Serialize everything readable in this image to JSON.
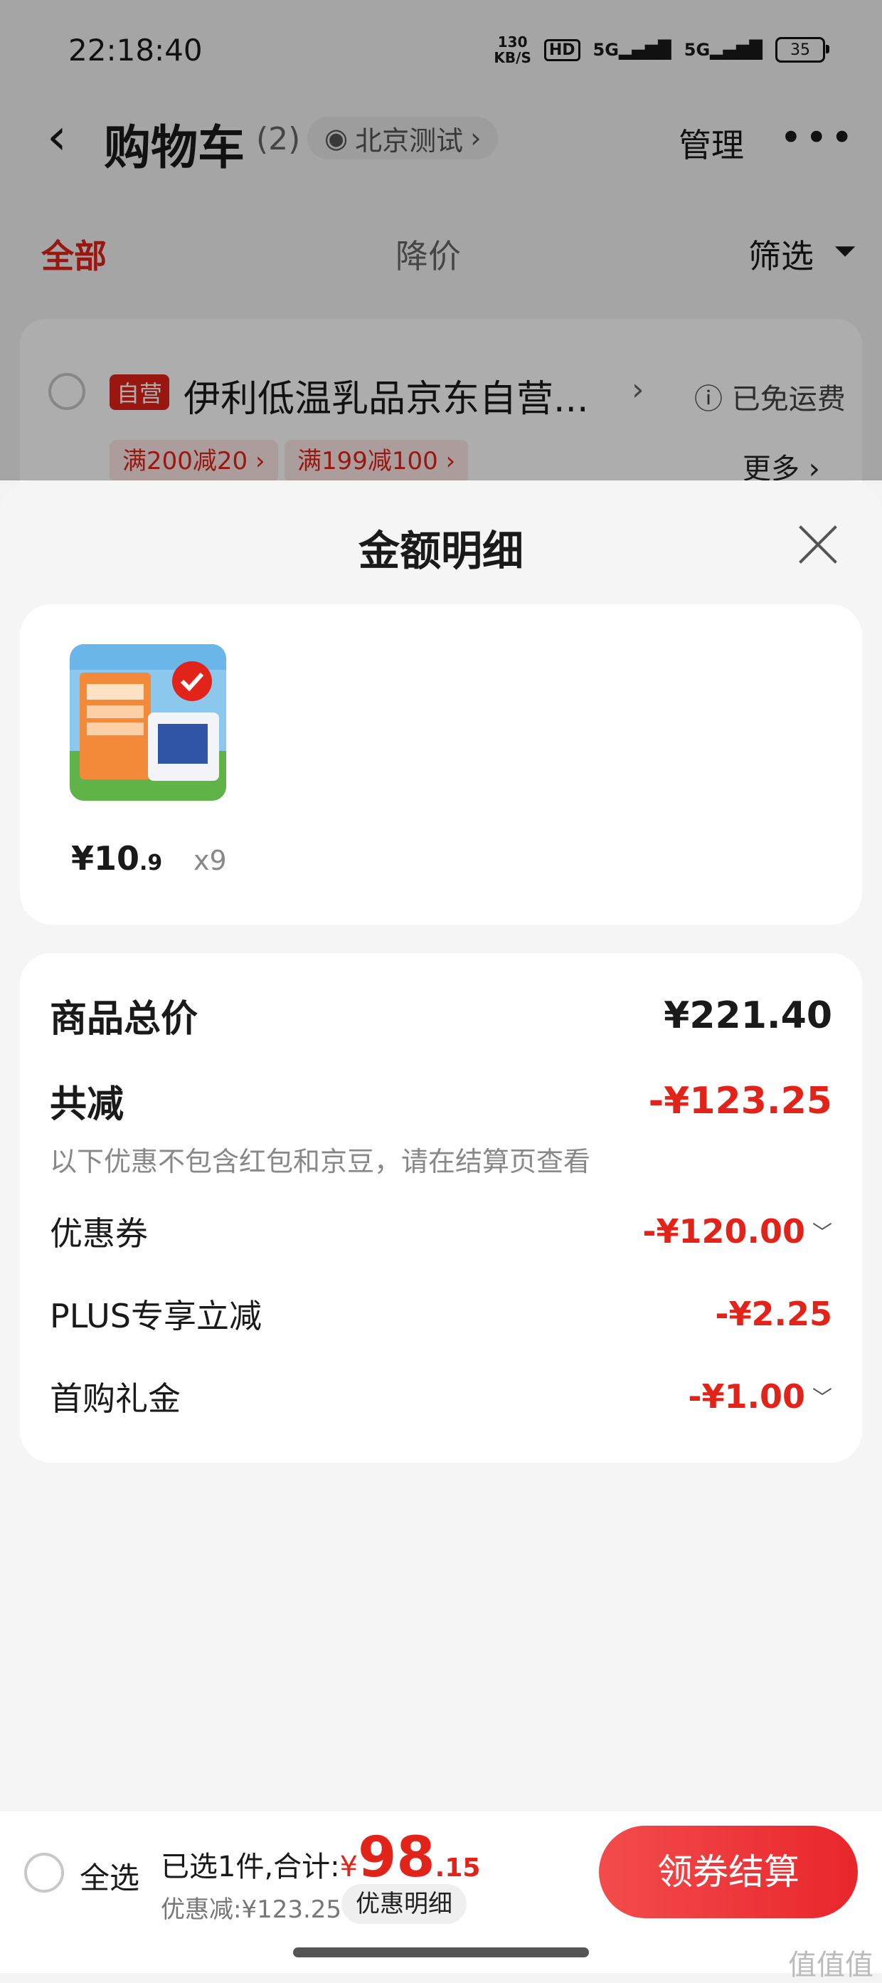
{
  "status_bar": {
    "time": "22:18:40",
    "net_speed_value": "130",
    "net_speed_unit": "KB/S",
    "hd": "HD",
    "signal1": "5G",
    "signal2": "5G",
    "battery": "35"
  },
  "nav": {
    "title": "购物车",
    "count": "(2)",
    "location": "北京测试",
    "manage": "管理",
    "more": "•••"
  },
  "tabs": {
    "all": "全部",
    "price_drop": "降价",
    "filter": "筛选"
  },
  "shop": {
    "badge": "自营",
    "name": "伊利低温乳品京东自营...",
    "shipping": "已免运费",
    "coupons": [
      "满200减20 ›",
      "满199减100 ›"
    ],
    "more": "更多 ›"
  },
  "sheet": {
    "title": "金额明细",
    "product": {
      "price_int": "¥10",
      "price_dec": ".9",
      "qty": "x9"
    },
    "total_label": "商品总价",
    "total_value": "¥221.40",
    "reduce_label": "共减",
    "reduce_value": "-¥123.25",
    "note": "以下优惠不包含红包和京豆，请在结算页查看",
    "items": [
      {
        "label": "优惠券",
        "value": "-¥120.00",
        "expand": "﹀"
      },
      {
        "label": "PLUS专享立减",
        "value": "-¥2.25",
        "expand": ""
      },
      {
        "label": "首购礼金",
        "value": "-¥1.00",
        "expand": "﹀"
      }
    ]
  },
  "bottom": {
    "select_all": "全选",
    "selected_text": "已选1件,合计:",
    "currency": "¥",
    "total_int": "98",
    "total_dec": ".15",
    "discount_text": "优惠减:¥123.25",
    "detail_btn": "优惠明细",
    "checkout_btn": "领券结算"
  },
  "watermark": "值值值",
  "colors": {
    "accent": "#e2231a"
  }
}
